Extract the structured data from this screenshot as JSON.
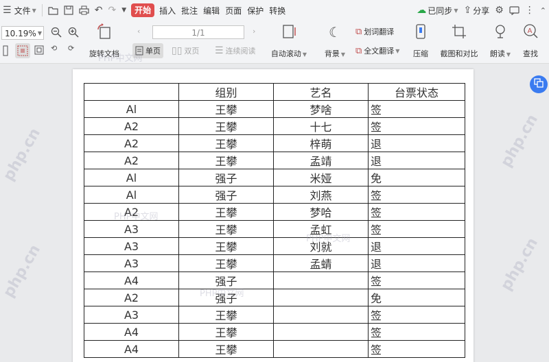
{
  "menubar": {
    "file_label": "文件",
    "tabs": [
      {
        "label": "开始",
        "active": true
      },
      {
        "label": "插入"
      },
      {
        "label": "批注"
      },
      {
        "label": "编辑"
      },
      {
        "label": "页面"
      },
      {
        "label": "保护"
      },
      {
        "label": "转换"
      }
    ],
    "sync_label": "已同步",
    "share_label": "分享"
  },
  "toolbar": {
    "zoom_value": "10.19%",
    "rotate_label": "旋转文档",
    "page_indicator": "1/1",
    "single_page_label": "单页",
    "double_page_label": "双页",
    "continuous_label": "连续阅读",
    "auto_scroll_label": "自动滚动",
    "background_label": "背景",
    "word_translate_label": "划词翻译",
    "full_translate_label": "全文翻译",
    "compress_label": "压缩",
    "screenshot_compare_label": "截图和对比",
    "read_aloud_label": "朗读",
    "find_label": "查找"
  },
  "watermarks": {
    "php_cn": "PHP中文网",
    "side": "php.cn"
  },
  "table": {
    "headers": [
      "",
      "组别",
      "艺名",
      "台票状态"
    ],
    "rows": [
      [
        "Al",
        "王攀",
        "梦啥",
        "签"
      ],
      [
        "A2",
        "王攀",
        "十七",
        "签"
      ],
      [
        "A2",
        "王攀",
        "梓萌",
        "退"
      ],
      [
        "A2",
        "王攀",
        "孟靖",
        "退"
      ],
      [
        "Al",
        "强子",
        "米娅",
        "免"
      ],
      [
        "Al",
        "强子",
        "刘燕",
        "签"
      ],
      [
        "A2",
        "王攀",
        "梦哈",
        "签"
      ],
      [
        "A3",
        "王攀",
        "孟虹",
        "签"
      ],
      [
        "A3",
        "王攀",
        "刘就",
        "退"
      ],
      [
        "A3",
        "王攀",
        "孟蜻",
        "退"
      ],
      [
        "A4",
        "强子",
        "",
        "签"
      ],
      [
        "A2",
        "强子",
        "",
        "免"
      ],
      [
        "A3",
        "王攀",
        "",
        "签"
      ],
      [
        "A4",
        "王攀",
        "",
        "签"
      ],
      [
        "A4",
        "王攀",
        "",
        "签"
      ]
    ]
  }
}
